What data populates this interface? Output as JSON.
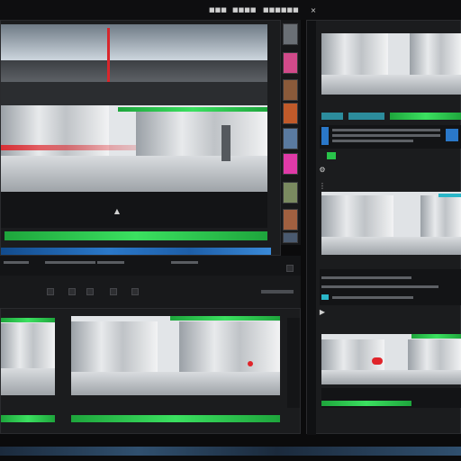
{
  "menubar": {
    "items": [
      "■■■",
      "■■■■",
      "■■■■■■"
    ]
  },
  "thumbnails": [
    {
      "color": "#6a6f75"
    },
    {
      "color": "#d14a8a"
    },
    {
      "color": "#8a5a3a"
    },
    {
      "color": "#c05a2a"
    },
    {
      "color": "#5a7aa0"
    },
    {
      "color": "#e03aa8"
    },
    {
      "color": "#7a8a60"
    },
    {
      "color": "#a06040"
    },
    {
      "color": "#4a5a70"
    }
  ],
  "icons": {
    "play": "▶",
    "marker": "▲",
    "close": "×",
    "gear": "⚙",
    "grip": "⋮"
  },
  "colors": {
    "accent_green": "#29c34a",
    "accent_blue": "#2a78c9",
    "accent_red": "#e0242a",
    "panel_bg": "#1b1c1e"
  }
}
